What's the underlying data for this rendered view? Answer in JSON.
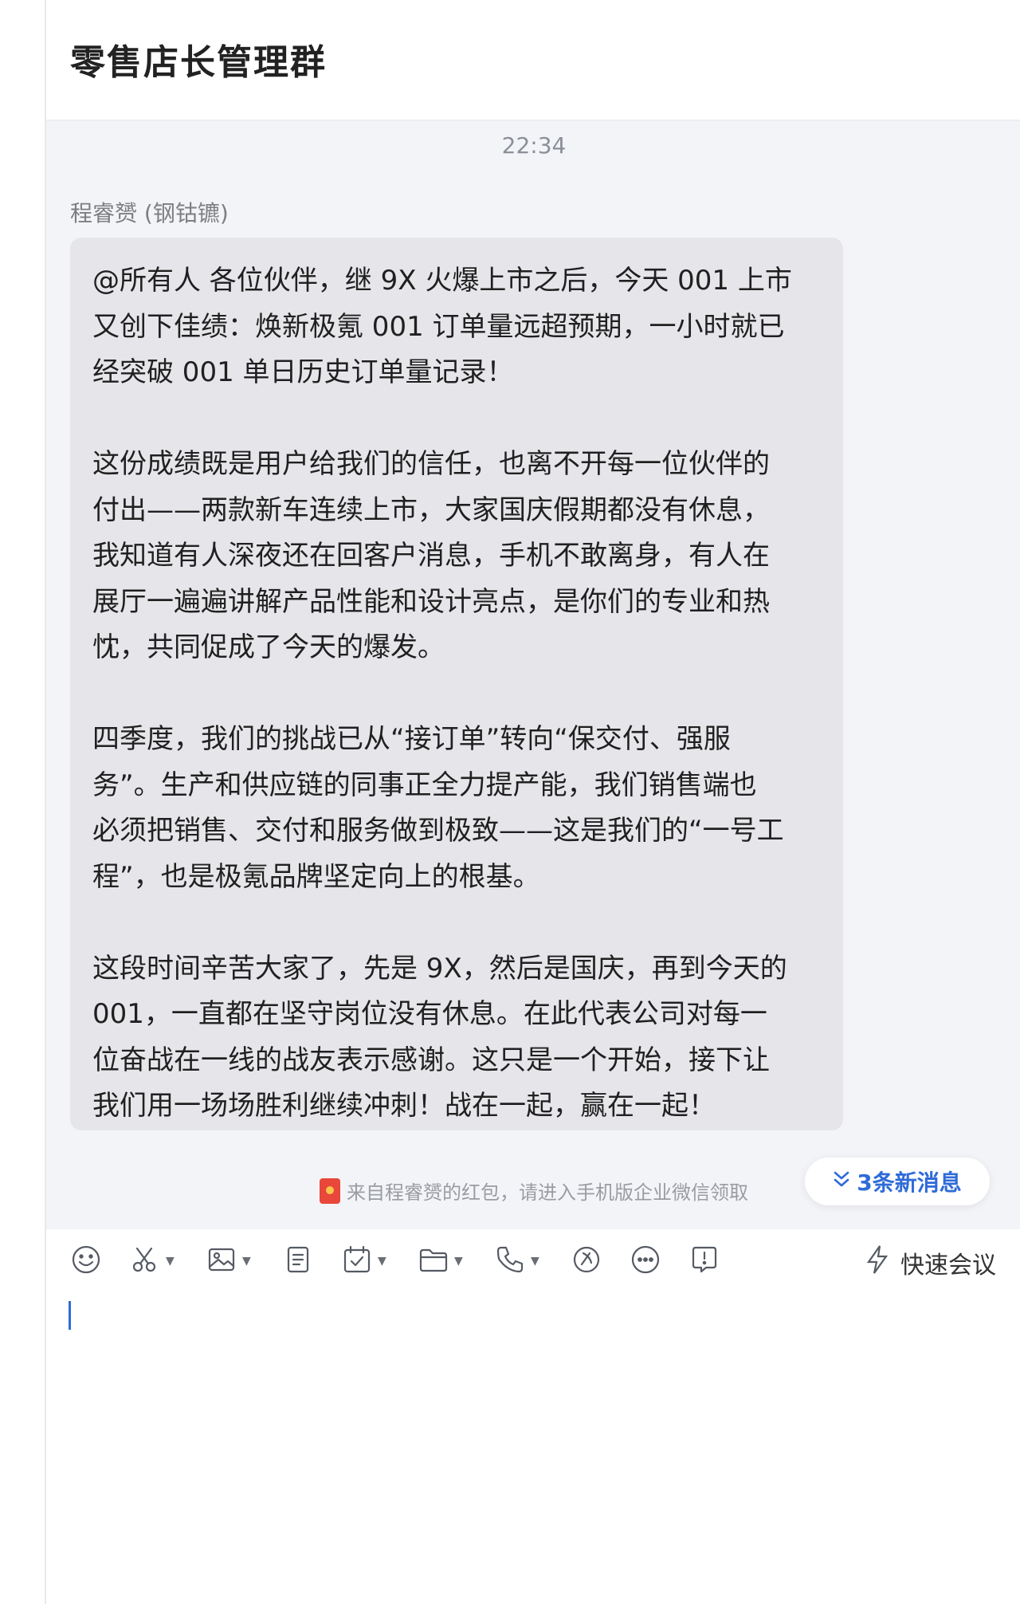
{
  "header": {
    "title": "零售店长管理群"
  },
  "chat": {
    "timestamp": "22:34",
    "sender": "程睿赟 (钢钴镳)",
    "message_paragraphs": [
      "@所有人 各位伙伴，继 9X 火爆上市之后，今天 001 上市\n又创下佳绩：焕新极氪 001 订单量远超预期，一小时就已\n经突破 001 单日历史订单量记录！",
      "这份成绩既是用户给我们的信任，也离不开每一位伙伴的\n付出——两款新车连续上市，大家国庆假期都没有休息，\n我知道有人深夜还在回客户消息，手机不敢离身，有人在\n展厅一遍遍讲解产品性能和设计亮点，是你们的专业和热\n忱，共同促成了今天的爆发。",
      "四季度，我们的挑战已从“接订单”转向“保交付、强服\n务”。生产和供应链的同事正全力提产能，我们销售端也\n必须把销售、交付和服务做到极致——这是我们的“一号工\n程”，也是极氪品牌坚定向上的根基。",
      "这段时间辛苦大家了，先是 9X，然后是国庆，再到今天的\n001，一直都在坚守岗位没有休息。在此代表公司对每一\n位奋战在一线的战友表示感谢。这只是一个开始，接下让\n我们用一场场胜利继续冲刺！战在一起，赢在一起！"
    ],
    "new_messages_label": "3条新消息",
    "red_packet_notice": "来自程睿赟的红包，请进入手机版企业微信领取"
  },
  "toolbar": {
    "icons": [
      "emoji-icon",
      "scissors-icon",
      "image-icon",
      "document-icon",
      "calendar-icon",
      "folder-icon",
      "phone-icon",
      "video-icon",
      "more-icon",
      "chat-record-icon"
    ],
    "quick_meeting_label": "快速会议"
  },
  "colors": {
    "accent": "#2f6bd8",
    "bubble": "#e6e6ea",
    "chat_bg": "#f3f4f8",
    "red_packet": "#e8473a"
  }
}
